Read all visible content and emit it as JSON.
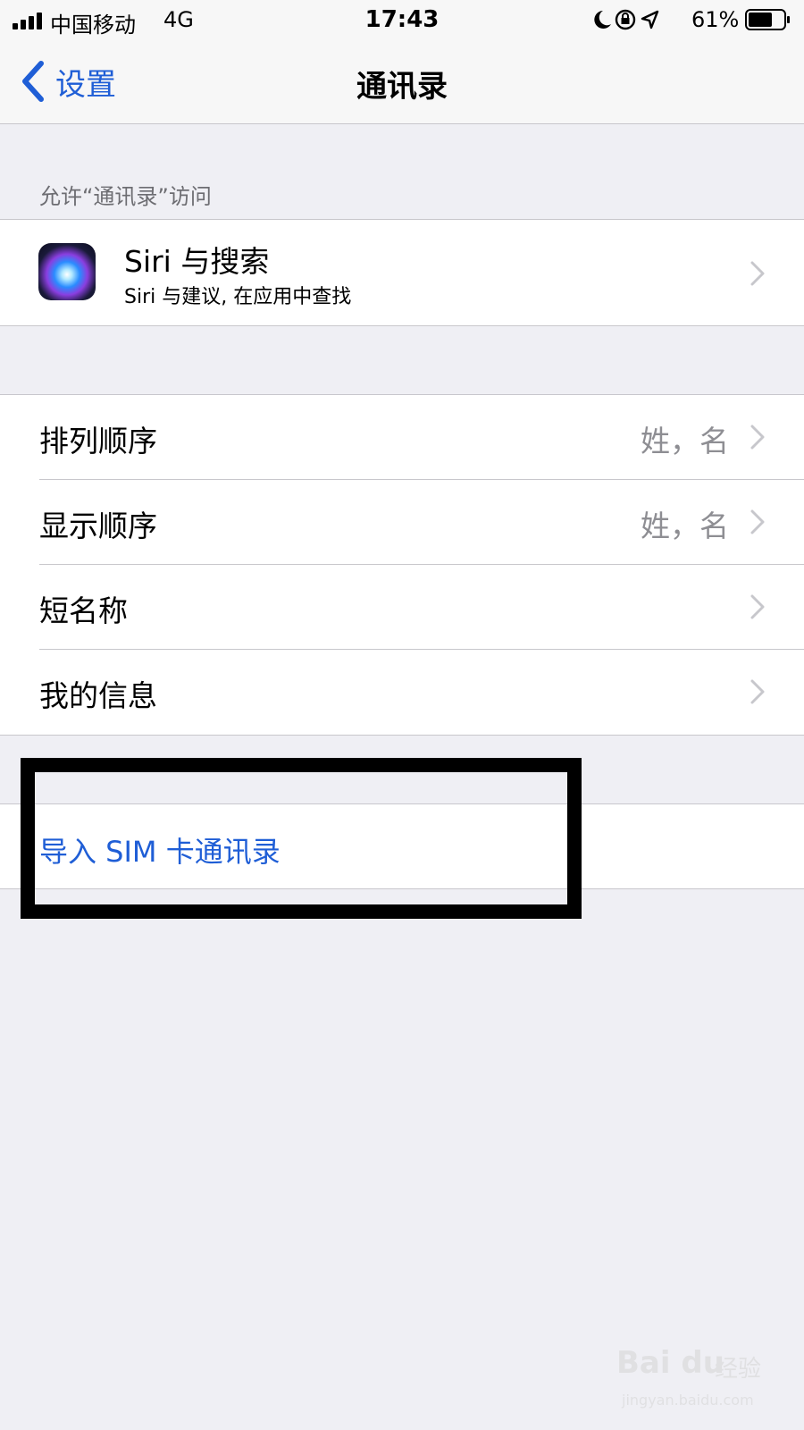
{
  "status_bar": {
    "carrier": "中国移动",
    "network": "4G",
    "time": "17:43",
    "battery_percent": "61%",
    "icons": [
      "signal-icon",
      "moon-icon",
      "orientation-lock-icon",
      "location-arrow-icon",
      "battery-icon"
    ]
  },
  "nav": {
    "back_label": "设置",
    "title": "通讯录"
  },
  "section_header": "允许“通讯录”访问",
  "siri": {
    "title": "Siri 与搜索",
    "subtitle": "Siri 与建议, 在应用中查找"
  },
  "settings": [
    {
      "label": "排列顺序",
      "value": "姓，名"
    },
    {
      "label": "显示顺序",
      "value": "姓，名"
    },
    {
      "label": "短名称",
      "value": ""
    },
    {
      "label": "我的信息",
      "value": ""
    }
  ],
  "import_sim": "导入 SIM 卡通讯录",
  "watermark": {
    "logo": "Bai du",
    "text": "经验",
    "url": "jingyan.baidu.com"
  },
  "colors": {
    "accent": "#1f5ed6",
    "background": "#efeff4",
    "secondary_text": "#8e8e93"
  }
}
